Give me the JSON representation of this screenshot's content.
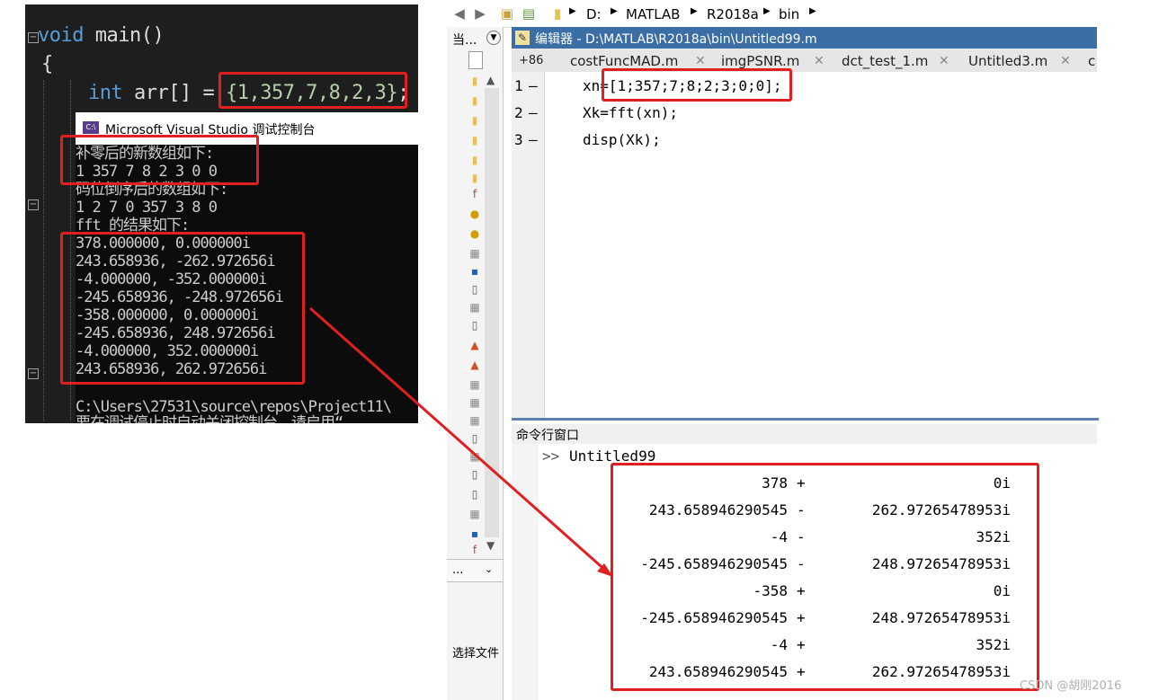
{
  "vs": {
    "line1": "void main()",
    "line2": "{",
    "line3_kw": "int",
    "line3_var": "arr[] =",
    "line3_vals": "{1,357,7,8,2,3}",
    "line3_end": ";"
  },
  "console": {
    "title": "Microsoft Visual Studio 调试控制台",
    "lines": [
      "补零后的新数组如下:",
      "1 357 7 8 2 3 0 0",
      "码位倒序后的数组如下:",
      "1 2 7 0 357 3 8 0",
      "fft 的结果如下:",
      "378.000000, 0.000000i",
      "243.658936, -262.972656i",
      "-4.000000, -352.000000i",
      "-245.658936, -248.972656i",
      "-358.000000, 0.000000i",
      "-245.658936, 248.972656i",
      "-4.000000, 352.000000i",
      "243.658936, 262.972656i",
      "",
      "C:\\Users\\27531\\source\\repos\\Project11\\",
      "要在调试停止时自动关闭控制台，请启用“"
    ]
  },
  "matlab": {
    "breadcrumb": [
      "D:",
      "MATLAB",
      "R2018a",
      "bin"
    ],
    "left_panel_label": "当...",
    "left_bottom_label": "...",
    "select_file_label": "选择文件",
    "editor_title": "编辑器 - D:\\MATLAB\\R2018a\\bin\\Untitled99.m",
    "tab_overflow": "+86",
    "tabs": [
      "costFuncMAD.m",
      "imgPSNR.m",
      "dct_test_1.m",
      "Untitled3.m",
      "c"
    ],
    "code_lines": [
      {
        "num": "1",
        "text": "xn=[1;357;7;8;2;3;0;0];"
      },
      {
        "num": "2",
        "text": "Xk=fft(xn);"
      },
      {
        "num": "3",
        "text": "disp(Xk);"
      }
    ],
    "cmd_title": "命令行窗口",
    "cmd_prompt": ">>",
    "cmd_input": "Untitled99",
    "results": [
      {
        "re": "378",
        "op": "+",
        "im": "0i"
      },
      {
        "re": "243.658946290545",
        "op": "-",
        "im": "262.97265478953i"
      },
      {
        "re": "-4",
        "op": "-",
        "im": "352i"
      },
      {
        "re": "-245.658946290545",
        "op": "-",
        "im": "248.97265478953i"
      },
      {
        "re": "-358",
        "op": "+",
        "im": "0i"
      },
      {
        "re": "-245.658946290545",
        "op": "+",
        "im": "248.97265478953i"
      },
      {
        "re": "-4",
        "op": "+",
        "im": "352i"
      },
      {
        "re": "243.658946290545",
        "op": "+",
        "im": "262.97265478953i"
      }
    ]
  },
  "watermark": "CSDN @胡刚2016",
  "colors": {
    "annotation": "#e02020",
    "vs_background": "#1e1e1e",
    "vs_keyword": "#569cd6",
    "matlab_title_bar": "#3b6ea5"
  }
}
